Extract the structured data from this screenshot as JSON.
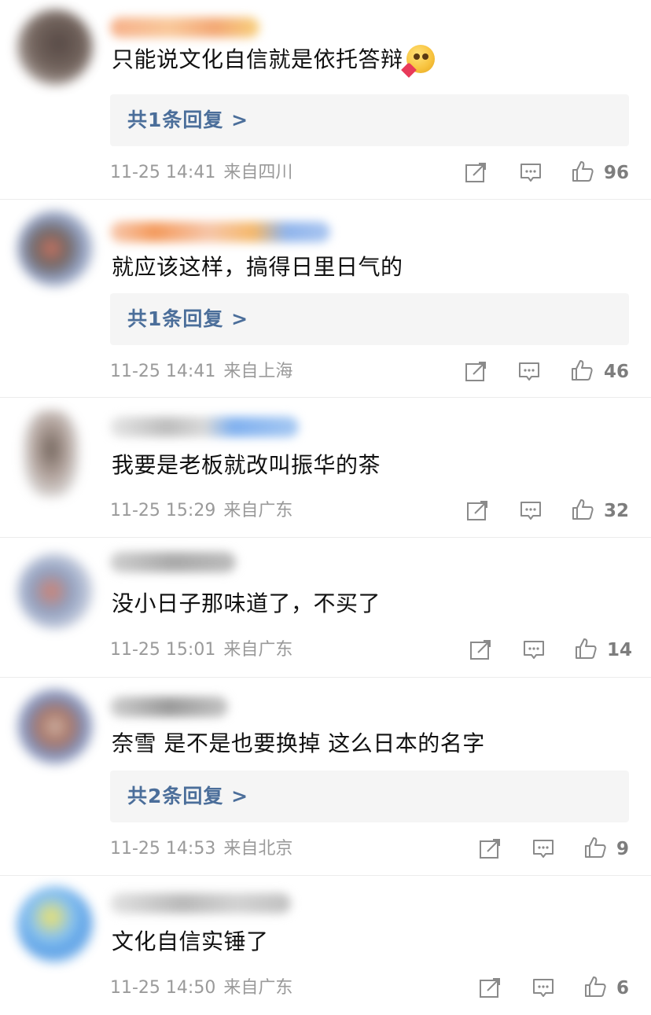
{
  "comments": [
    {
      "text": "只能说文化自信就是依托答辩",
      "has_emoji": true,
      "emoji": "heart-eyes-emoji",
      "reply_label": "共1条回复 >",
      "time": "11-25 14:41",
      "location": "来自四川",
      "likes": "96"
    },
    {
      "text": "就应该这样，搞得日里日气的",
      "reply_label": "共1条回复 >",
      "time": "11-25 14:41",
      "location": "来自上海",
      "likes": "46"
    },
    {
      "text": "我要是老板就改叫振华的茶",
      "time": "11-25 15:29",
      "location": "来自广东",
      "likes": "32"
    },
    {
      "text": "没小日子那味道了，不买了",
      "time": "11-25 15:01",
      "location": "来自广东",
      "likes": "14"
    },
    {
      "text": "奈雪 是不是也要换掉 这么日本的名字",
      "reply_label": "共2条回复 >",
      "time": "11-25 14:53",
      "location": "来自北京",
      "likes": "9"
    },
    {
      "text": "文化自信实锤了",
      "time": "11-25 14:50",
      "location": "来自广东",
      "likes": "6"
    }
  ],
  "colors": {
    "reply_link": "#4b6e9a",
    "meta_text": "#9a9a9a",
    "reply_bg": "#f5f5f5",
    "divider": "#ececec"
  },
  "icons": [
    "share-icon",
    "comment-icon",
    "like-icon"
  ]
}
